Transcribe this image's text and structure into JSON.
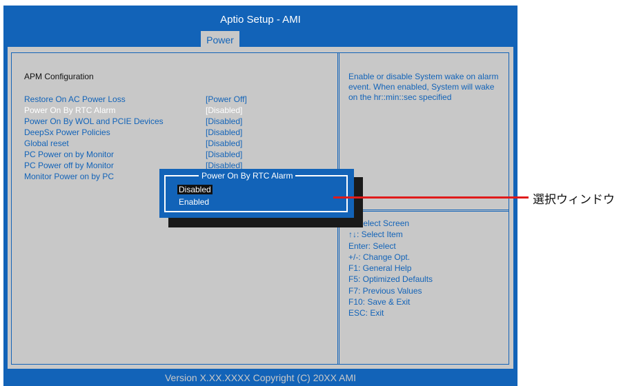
{
  "window": {
    "title": "Aptio Setup - AMI",
    "active_tab": "Power",
    "footer": "Version X.XX.XXXX Copyright (C) 20XX AMI"
  },
  "main": {
    "section_title": "APM Configuration",
    "settings": [
      {
        "label": "Restore On AC Power Loss",
        "value": "[Power Off]"
      },
      {
        "label": "Power On By RTC Alarm",
        "value": "[Disabled]"
      },
      {
        "label": "Power On By WOL and PCIE Devices",
        "value": "[Disabled]"
      },
      {
        "label": "DeepSx Power Policies",
        "value": "[Disabled]"
      },
      {
        "label": "Global reset",
        "value": "[Disabled]"
      },
      {
        "label": "PC Power on by Monitor",
        "value": "[Disabled]"
      },
      {
        "label": "PC Power off by Monitor",
        "value": "[Disabled]"
      },
      {
        "label": "Monitor Power on by PC",
        "value": ""
      }
    ]
  },
  "help": {
    "description": "Enable or disable System wake on alarm event. When enabled, System will wake on the hr::min::sec specified",
    "keys": [
      "  : Select Screen",
      "↑↓: Select Item",
      "Enter: Select",
      "+/-: Change Opt.",
      "F1: General Help",
      "F5: Optimized Defaults",
      "F7: Previous Values",
      "F10: Save & Exit",
      "ESC: Exit"
    ]
  },
  "popup": {
    "title": "Power On By RTC Alarm",
    "options": [
      "Disabled",
      "Enabled"
    ],
    "selected": "Disabled"
  },
  "annotation": {
    "label": "選択ウィンドウ"
  },
  "colors": {
    "bios_blue": "#1263b8",
    "panel_gray": "#c8c8c8",
    "callout_red": "#e01a1a"
  }
}
